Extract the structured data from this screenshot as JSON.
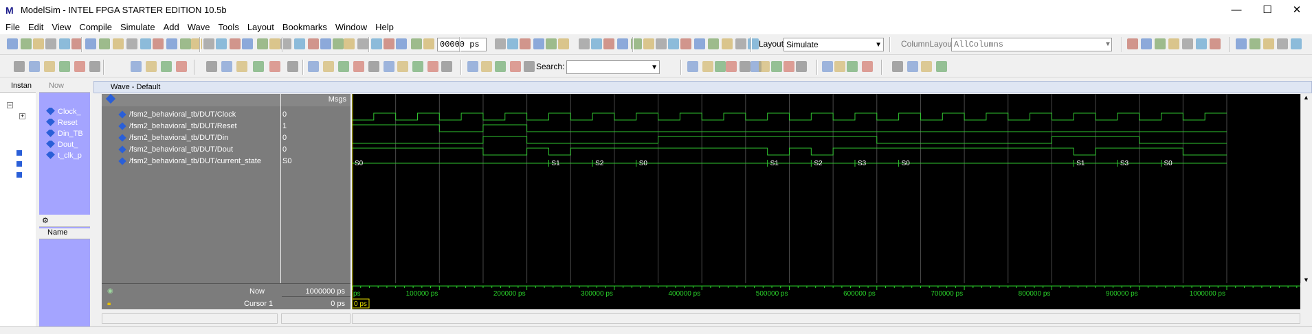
{
  "window": {
    "title": "ModelSim - INTEL FPGA STARTER EDITION 10.5b",
    "logo": "M",
    "minimize": "—",
    "maximize": "☐",
    "close": "✕"
  },
  "menu": [
    "File",
    "Edit",
    "View",
    "Compile",
    "Simulate",
    "Add",
    "Wave",
    "Tools",
    "Layout",
    "Bookmarks",
    "Window",
    "Help"
  ],
  "toolbar": {
    "time_value": "00000 ps",
    "layout_label": "Layout",
    "layout_value": "Simulate",
    "column_layout_label": "ColumnLayout",
    "column_layout_value": "AllColumns",
    "search_label": "Search:",
    "search_value": ""
  },
  "left_pane": {
    "tab_label": "Instan"
  },
  "objects_pane": {
    "tab_label": "Now",
    "items": [
      "Clock_",
      "Reset",
      "Din_TB",
      "Dout_",
      "t_clk_p"
    ]
  },
  "processes_pane": {
    "column_header": "Name"
  },
  "wave": {
    "title": "Wave - Default",
    "msgs_header": "Msgs",
    "signals": [
      {
        "name": "/fsm2_behavioral_tb/DUT/Clock",
        "value": "0"
      },
      {
        "name": "/fsm2_behavioral_tb/DUT/Reset",
        "value": "1"
      },
      {
        "name": "/fsm2_behavioral_tb/DUT/Din",
        "value": "0"
      },
      {
        "name": "/fsm2_behavioral_tb/DUT/Dout",
        "value": "0"
      },
      {
        "name": "/fsm2_behavioral_tb/DUT/current_state",
        "value": "S0"
      }
    ],
    "state_labels": [
      "S0",
      "S1",
      "S2",
      "S0",
      "S1",
      "S2",
      "S3",
      "S0",
      "S1",
      "S3",
      "S0"
    ],
    "now_label": "Now",
    "now_value": "1000000 ps",
    "cursor_label": "Cursor 1",
    "cursor_value": "0 ps",
    "cursor_marker": "0 ps",
    "timeline_labels": [
      "ps",
      "100000 ps",
      "200000 ps",
      "300000 ps",
      "400000 ps",
      "500000 ps",
      "600000 ps",
      "700000 ps",
      "800000 ps",
      "900000 ps",
      "1000000 ps"
    ],
    "colors": {
      "wave": "#31c631",
      "background": "#000000",
      "grid": "#4a4a4a",
      "cursor": "#e8e000",
      "timeline_text": "#2ad22a"
    }
  }
}
